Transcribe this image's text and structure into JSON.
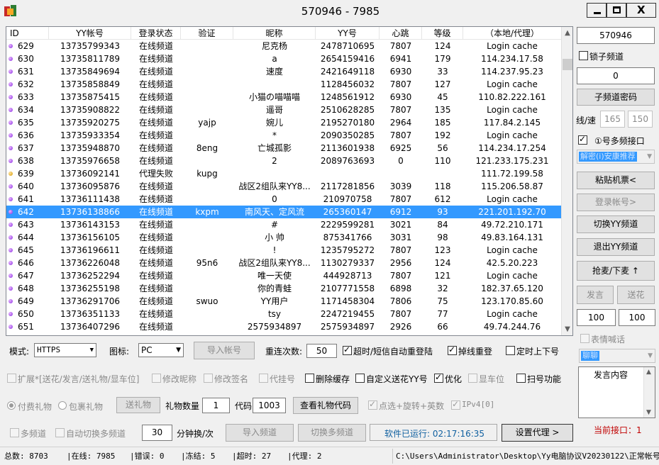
{
  "window": {
    "title": "570946 - 7985",
    "min": "",
    "max": "",
    "close": "X"
  },
  "table": {
    "columns": [
      "ID",
      "YY帐号",
      "登录状态",
      "验证",
      "昵称",
      "YY号",
      "心跳",
      "等级",
      "（本地/代理）"
    ],
    "rows": [
      {
        "id": "629",
        "account": "13735799343",
        "status": "在线频道",
        "verify": "",
        "nick": "尼克杨",
        "yy": "2478710695",
        "hb": "7807",
        "level": "124",
        "proxy": "Login cache"
      },
      {
        "id": "630",
        "account": "13735811789",
        "status": "在线频道",
        "verify": "",
        "nick": "a",
        "yy": "2654159416",
        "hb": "6941",
        "level": "179",
        "proxy": "114.234.17.58"
      },
      {
        "id": "631",
        "account": "13735849694",
        "status": "在线频道",
        "verify": "",
        "nick": "速度",
        "yy": "2421649118",
        "hb": "6930",
        "level": "33",
        "proxy": "114.237.95.23"
      },
      {
        "id": "632",
        "account": "13735858849",
        "status": "在线频道",
        "verify": "",
        "nick": "",
        "yy": "1128456032",
        "hb": "7807",
        "level": "127",
        "proxy": "Login cache"
      },
      {
        "id": "633",
        "account": "13735875415",
        "status": "在线频道",
        "verify": "",
        "nick": "小猫の喵喵喵",
        "yy": "1248561912",
        "hb": "6930",
        "level": "45",
        "proxy": "110.82.222.161"
      },
      {
        "id": "634",
        "account": "13735908822",
        "status": "在线频道",
        "verify": "",
        "nick": "遥哥",
        "yy": "2510628285",
        "hb": "7807",
        "level": "135",
        "proxy": "Login cache"
      },
      {
        "id": "635",
        "account": "13735920275",
        "status": "在线频道",
        "verify": "yajp",
        "nick": "婉儿",
        "yy": "2195270180",
        "hb": "2964",
        "level": "185",
        "proxy": "117.84.2.145"
      },
      {
        "id": "636",
        "account": "13735933354",
        "status": "在线频道",
        "verify": "",
        "nick": "*",
        "yy": "2090350285",
        "hb": "7807",
        "level": "192",
        "proxy": "Login cache"
      },
      {
        "id": "637",
        "account": "13735948870",
        "status": "在线频道",
        "verify": "8eng",
        "nick": "亡城孤影",
        "yy": "2113601938",
        "hb": "6925",
        "level": "56",
        "proxy": "114.234.17.254"
      },
      {
        "id": "638",
        "account": "13735976658",
        "status": "在线频道",
        "verify": "",
        "nick": "2",
        "yy": "2089763693",
        "hb": "0",
        "level": "110",
        "proxy": "121.233.175.231"
      },
      {
        "id": "639",
        "account": "13736092141",
        "status": "代理失败",
        "verify": "kupg",
        "nick": "",
        "yy": "",
        "hb": "",
        "level": "",
        "proxy": "111.72.199.58",
        "warn": true
      },
      {
        "id": "640",
        "account": "13736095876",
        "status": "在线频道",
        "verify": "",
        "nick": "战区2组队来YY8...",
        "yy": "2117281856",
        "hb": "3039",
        "level": "118",
        "proxy": "115.206.58.87"
      },
      {
        "id": "641",
        "account": "13736111438",
        "status": "在线频道",
        "verify": "",
        "nick": "0",
        "yy": "210970758",
        "hb": "7807",
        "level": "612",
        "proxy": "Login cache"
      },
      {
        "id": "642",
        "account": "13736138866",
        "status": "在线频道",
        "verify": "kxpm",
        "nick": "南风天、定风流",
        "yy": "265360147",
        "hb": "6912",
        "level": "93",
        "proxy": "221.201.192.70",
        "selected": true
      },
      {
        "id": "643",
        "account": "13736143153",
        "status": "在线频道",
        "verify": "",
        "nick": "#",
        "yy": "2229599281",
        "hb": "3021",
        "level": "84",
        "proxy": "49.72.210.171"
      },
      {
        "id": "644",
        "account": "13736156105",
        "status": "在线频道",
        "verify": "",
        "nick": "小 帅",
        "yy": "875341766",
        "hb": "3031",
        "level": "98",
        "proxy": "49.83.164.131"
      },
      {
        "id": "645",
        "account": "13736196611",
        "status": "在线频道",
        "verify": "",
        "nick": "!",
        "yy": "1235795272",
        "hb": "7807",
        "level": "123",
        "proxy": "Login cache"
      },
      {
        "id": "646",
        "account": "13736226048",
        "status": "在线频道",
        "verify": "95n6",
        "nick": "战区2组队来YY8...",
        "yy": "1130279337",
        "hb": "2956",
        "level": "124",
        "proxy": "42.5.20.223"
      },
      {
        "id": "647",
        "account": "13736252294",
        "status": "在线频道",
        "verify": "",
        "nick": "唯一天使",
        "yy": "444928713",
        "hb": "7807",
        "level": "121",
        "proxy": "Login cache"
      },
      {
        "id": "648",
        "account": "13736255198",
        "status": "在线频道",
        "verify": "",
        "nick": "你的青蛙",
        "yy": "2107771558",
        "hb": "6898",
        "level": "32",
        "proxy": "182.37.65.120"
      },
      {
        "id": "649",
        "account": "13736291706",
        "status": "在线频道",
        "verify": "swuo",
        "nick": "YY用户",
        "yy": "1171458304",
        "hb": "7806",
        "level": "75",
        "proxy": "123.170.85.60"
      },
      {
        "id": "650",
        "account": "13736351133",
        "status": "在线频道",
        "verify": "",
        "nick": "tsy",
        "yy": "2247219455",
        "hb": "7807",
        "level": "77",
        "proxy": "Login cache"
      },
      {
        "id": "651",
        "account": "13736407296",
        "status": "在线频道",
        "verify": "",
        "nick": "2575934897",
        "yy": "2575934897",
        "hb": "2926",
        "level": "66",
        "proxy": "49.74.244.76"
      }
    ]
  },
  "right": {
    "channel_id": "570946",
    "lock_channel": "锁子频道",
    "sub_channel": "0",
    "sub_pwd_btn": "子频道密码",
    "thread_label": "线/速",
    "thread_a": "165",
    "thread_b": "150",
    "multi_label": "①号多频接口",
    "multi_combo": "解密(i)安康推荐",
    "paste_btn": "粘贴机票<",
    "login_btn": "登录帐号>",
    "switch_btn": "切换YY频道",
    "exit_btn": "退出YY频道",
    "grab_btn": "抢麦/下麦 ↑",
    "speak_btn": "发言",
    "gift_btn": "送花",
    "speak_num": "100",
    "gift_num": "100",
    "emoji_label": "表情喊话",
    "emoji_combo": "聊聊",
    "speech_label": "发言内容",
    "current_port": "当前接口：1"
  },
  "options1": {
    "mode_label": "模式:",
    "mode_value": "HTTPS",
    "icon_label": "图标:",
    "icon_value": "PC",
    "import_btn": "导入帐号",
    "retry_label": "重连次数:",
    "retry_value": "50",
    "timeout_label": "超时/短信自动重登陆",
    "drop_label": "掉线重登",
    "timer_label": "定时上下号"
  },
  "options2": {
    "ext_label": "扩展*[送花/发言/送礼物/显车位]",
    "rename_label": "修改昵称",
    "sign_label": "修改签名",
    "hang_label": "代挂号",
    "clear_label": "删除缓存",
    "custom_label": "自定义送花YY号",
    "opt_label": "优化",
    "car_label": "显车位",
    "scan_label": "扫号功能"
  },
  "options3": {
    "paid_label": "付费礼物",
    "pkg_label": "包裹礼物",
    "send_btn": "送礼物",
    "qty_label": "礼物数量",
    "qty_value": "1",
    "code_label": "代码",
    "code_value": "1003",
    "check_btn": "查看礼物代码",
    "click_label": "点选+旋转+英数",
    "ipv4_label": "IPv4[0]"
  },
  "options4": {
    "multi_label": "多频道",
    "auto_label": "自动切换多频道",
    "minutes_value": "30",
    "minutes_label": "分钟换/次",
    "import_ch_btn": "导入频道",
    "switch_multi_btn": "切换多频道",
    "runtime": "软件已运行: 02:17:16:35",
    "proxy_btn": "设置代理 >"
  },
  "status": {
    "total": "总数: 8703",
    "online": "|在线: 7985",
    "error": "|错误: 0",
    "frozen": "|冻结: 5",
    "timeout": "|超时: 27",
    "proxy": "|代理: 2",
    "path": "C:\\Users\\Administrator\\Desktop\\Yy电脑协议V20230122\\正常帐号+"
  },
  "colors": {
    "selection": "#3399ff",
    "online_dot": "#8a2be2",
    "warn_dot": "#d69a00",
    "runtime_text": "#1060a0",
    "port_text": "#c00000"
  }
}
